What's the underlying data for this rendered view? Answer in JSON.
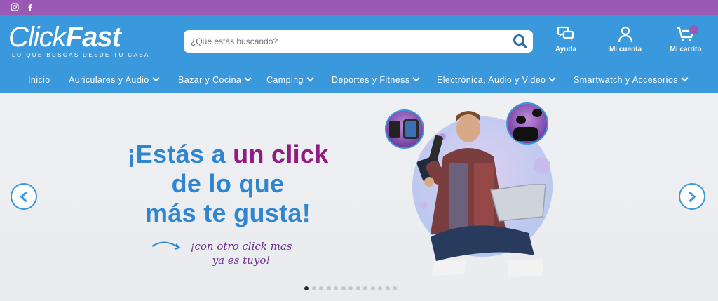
{
  "topbar": {
    "social": [
      {
        "name": "instagram-icon"
      },
      {
        "name": "facebook-icon"
      }
    ]
  },
  "brand": {
    "name_part1": "Click",
    "name_part2": "Fast",
    "tagline": "LO QUE BUSCAS DESDE TU CASA"
  },
  "search": {
    "placeholder": "¿Qué estás buscando?"
  },
  "header_actions": {
    "help": "Ayuda",
    "account": "Mi cuenta",
    "cart": "Mi carrito",
    "cart_count": ""
  },
  "nav": {
    "items": [
      {
        "label": "Inicio"
      },
      {
        "label": "Auriculares y Audio"
      },
      {
        "label": "Bazar y Cocina"
      },
      {
        "label": "Camping"
      },
      {
        "label": "Deportes y Fitness"
      },
      {
        "label": "Electrónica, Audio y Video"
      },
      {
        "label": "Smartwatch y Accesorios"
      }
    ]
  },
  "hero": {
    "headline_1": "¡Estás a",
    "headline_2": "un click",
    "headline_3": "de lo que",
    "headline_4": "más te gusta!",
    "tagline_1": "¡con otro click mas",
    "tagline_2": "ya es tuyo!",
    "slide_count": 13,
    "active_slide": 1
  },
  "colors": {
    "topbar": "#9b59b6",
    "header": "#3a98dc",
    "headline_blue": "#2f86cf",
    "headline_purple": "#8e1c82"
  }
}
